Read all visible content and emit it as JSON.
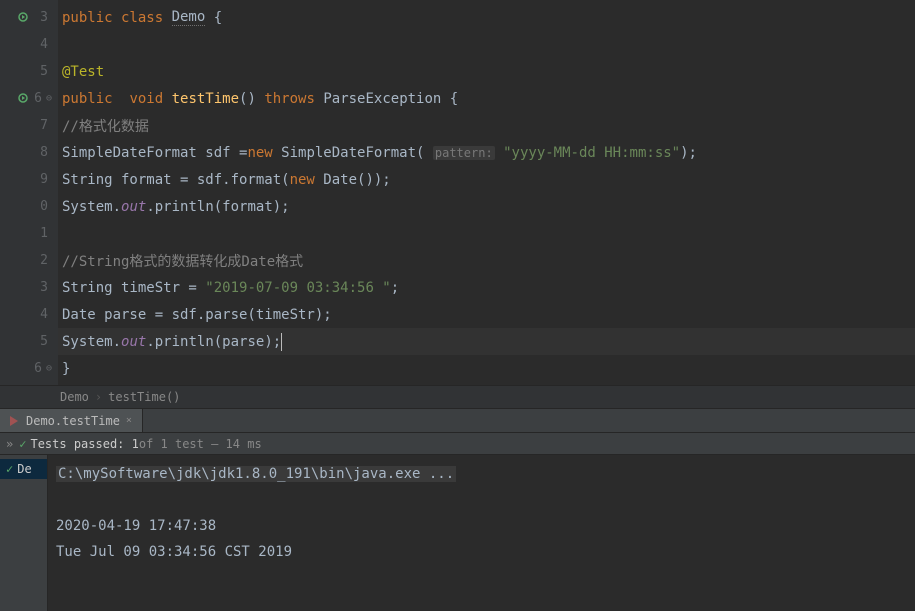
{
  "gutter": {
    "lines": [
      "3",
      "4",
      "5",
      "6",
      "7",
      "8",
      "9",
      "0",
      "1",
      "2",
      "3",
      "4",
      "5",
      "6"
    ]
  },
  "code": {
    "l3": {
      "kw1": "public class ",
      "name": "Demo",
      "brace": " {"
    },
    "l5": {
      "ann": "@Test"
    },
    "l6": {
      "kw1": "public  ",
      "kw2": "void ",
      "mth": "testTime",
      "parens": "() ",
      "kw3": "throws ",
      "exc": "ParseException {"
    },
    "l7": {
      "com": "//格式化数据"
    },
    "l8": {
      "t1": "SimpleDateFormat sdf =",
      "kw": "new ",
      "t2": "SimpleDateFormat( ",
      "hint": "pattern:",
      "sp": " ",
      "str": "\"yyyy-MM-dd HH:mm:ss\"",
      "t3": ");"
    },
    "l9": {
      "t1": "String format = sdf.format(",
      "kw": "new ",
      "t2": "Date());"
    },
    "l10": {
      "t1": "System.",
      "fld": "out",
      "t2": ".println(format);"
    },
    "l12": {
      "com": "//String格式的数据转化成Date格式"
    },
    "l13": {
      "t1": "String timeStr = ",
      "str": "\"2019-07-09 03:34:56 \"",
      "t2": ";"
    },
    "l14": {
      "t1": "Date parse = sdf.parse(timeStr);"
    },
    "l15": {
      "t1": "System.",
      "fld": "out",
      "t2": ".println(parse);"
    },
    "l16": {
      "brace": "}"
    }
  },
  "breadcrumb": {
    "a": "Demo",
    "b": "testTime()"
  },
  "tab": {
    "label": "Demo.testTime"
  },
  "tests": {
    "passed": "Tests passed: 1",
    "rest": " of 1 test – 14 ms"
  },
  "tree": {
    "item": "De"
  },
  "console": {
    "cmd": "C:\\mySoftware\\jdk\\jdk1.8.0_191\\bin\\java.exe ...",
    "out1": "2020-04-19 17:47:38",
    "out2": "Tue Jul 09 03:34:56 CST 2019"
  }
}
